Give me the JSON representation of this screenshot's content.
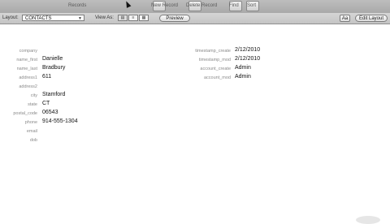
{
  "toolbar": {
    "records_label": "Records",
    "new_record": "New Record",
    "delete_record": "Delete Record",
    "find": "Find",
    "sort": "Sort"
  },
  "layoutbar": {
    "layout_label": "Layout:",
    "layout_value": "CONTACTS",
    "view_as_label": "View As:",
    "preview": "Preview",
    "aa": "Aa",
    "edit_layout": "Edit Layout"
  },
  "left_fields": [
    {
      "label": "company",
      "value": ""
    },
    {
      "label": "name_first",
      "value": "Danielle"
    },
    {
      "label": "name_last",
      "value": "Bradbury"
    },
    {
      "label": "address1",
      "value": "611"
    },
    {
      "label": "address2",
      "value": ""
    },
    {
      "label": "city",
      "value": "Stamford"
    },
    {
      "label": "state",
      "value": "CT"
    },
    {
      "label": "postal_code",
      "value": "06543"
    },
    {
      "label": "phone",
      "value": "914-555-1304"
    },
    {
      "label": "email",
      "value": ""
    },
    {
      "label": "dob",
      "value": ""
    }
  ],
  "right_fields": [
    {
      "label": "timestamp_create",
      "value": "2/12/2010"
    },
    {
      "label": "timestamp_mod",
      "value": "2/12/2010"
    },
    {
      "label": "account_create",
      "value": "Admin"
    },
    {
      "label": "account_mod",
      "value": "Admin"
    }
  ]
}
